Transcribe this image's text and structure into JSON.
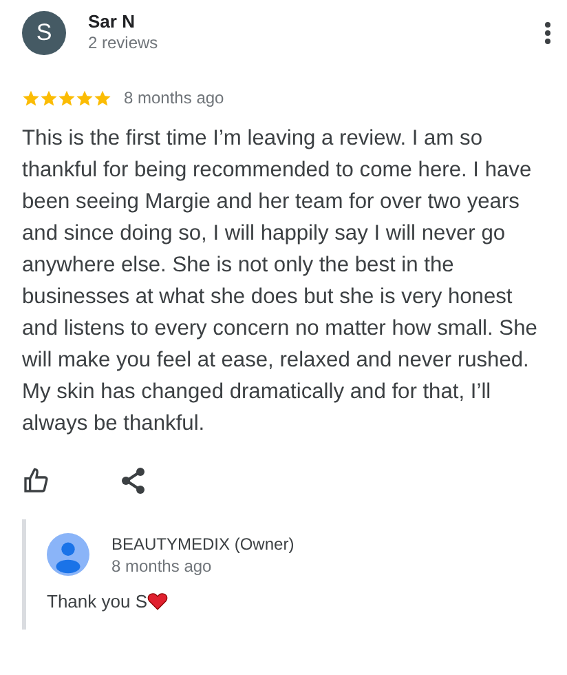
{
  "review": {
    "avatar_letter": "S",
    "author": "Sar N",
    "subtitle": "2 reviews",
    "stars": 5,
    "time": "8 months ago",
    "text": "This is the first time I’m leaving a review. I am so thankful for being recommended to come here. I have been seeing Margie and her team for over two years and since doing so, I will happily say I will never go anywhere else. She is not only the best in the businesses at what she does but she is very honest and listens to every concern no matter how small. She will make you feel at ease, relaxed and never rushed. My skin has changed dramatically and for that, I’ll always be thankful."
  },
  "reply": {
    "author": "BEAUTYMEDIX (Owner)",
    "time": "8 months ago",
    "text": "Thank you S"
  }
}
